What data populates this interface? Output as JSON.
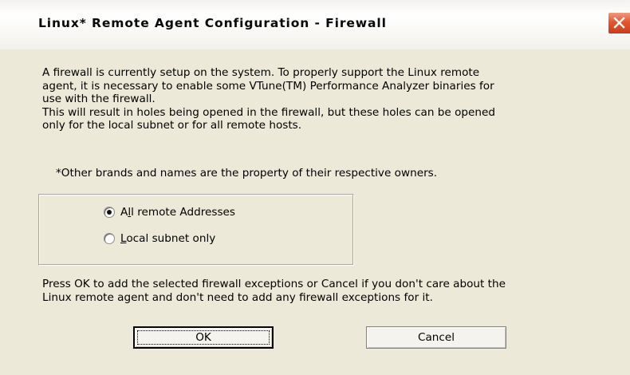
{
  "window": {
    "title": "Linux* Remote Agent Configuration - Firewall"
  },
  "body": {
    "intro_lines": [
      "A firewall is currently setup on the system. To properly support the Linux remote",
      "agent, it is necessary to enable some VTune(TM) Performance Analyzer binaries for",
      "use with the firewall.",
      "This will result in holes being opened in the firewall, but these holes can be opened",
      "only for the local subnet or for all remote hosts."
    ],
    "trademark_note": "*Other brands and names are the property of their respective owners.",
    "options": [
      {
        "label": "All remote Addresses",
        "mnemonic": "l",
        "checked": true
      },
      {
        "label": "Local subnet only",
        "mnemonic": "L",
        "checked": false
      }
    ],
    "instructions_lines": [
      "Press OK to add the selected firewall exceptions or Cancel if you don't care about the",
      "Linux remote agent and don't need to add any firewall exceptions for it."
    ]
  },
  "buttons": {
    "ok_label": "OK",
    "cancel_label": "Cancel"
  },
  "icons": {
    "close": "close-icon"
  },
  "colors": {
    "dialog_background": "#ece9d8",
    "close_button": "#e3562f"
  }
}
